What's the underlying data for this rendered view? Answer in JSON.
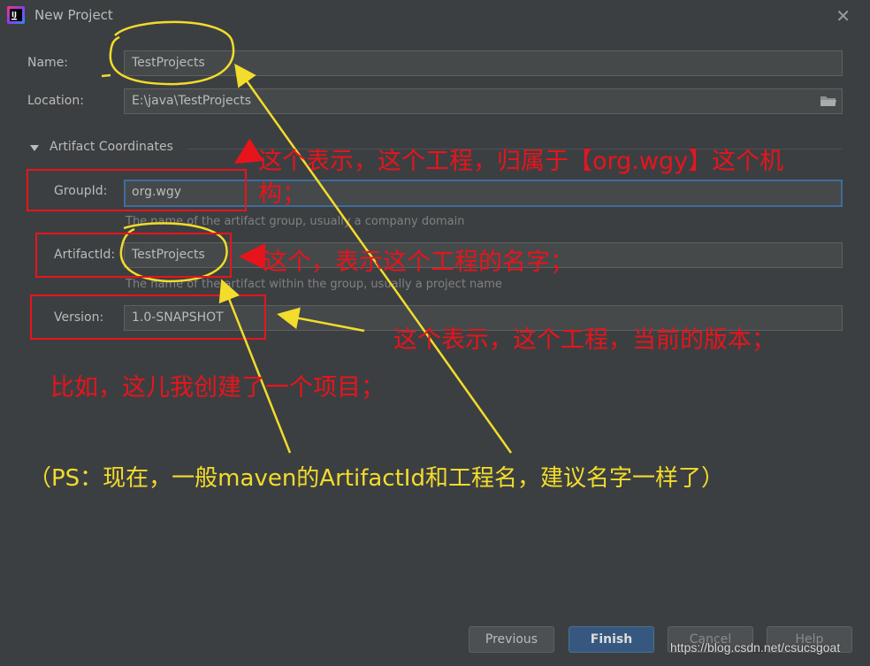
{
  "window": {
    "title": "New Project"
  },
  "form": {
    "name_label": "Name:",
    "name_value": "TestProjects",
    "location_label": "Location:",
    "location_value": "E:\\java\\TestProjects",
    "section_title": "Artifact Coordinates",
    "groupid_label": "GroupId:",
    "groupid_value": "org.wgy",
    "groupid_hint": "The name of the artifact group, usually a company domain",
    "artifactid_label": "ArtifactId:",
    "artifactid_value": "TestProjects",
    "artifactid_hint": "The name of the artifact within the group, usually a project name",
    "version_label": "Version:",
    "version_value": "1.0-SNAPSHOT"
  },
  "buttons": {
    "previous": "Previous",
    "finish": "Finish",
    "cancel": "Cancel",
    "help": "Help"
  },
  "annotations": {
    "groupid_note_line1": "这个表示，这个工程，归属于【org.wgy】这个机",
    "groupid_note_line2": "构；",
    "artifactid_note": "这个，表示这个工程的名字；",
    "version_note": "这个表示，这个工程，当前的版本；",
    "example_note": "比如，这儿我创建了一个项目；",
    "ps_note": "（PS：现在，一般maven的ArtifactId和工程名，建议名字一样了）"
  },
  "watermark": "https://blog.csdn.net/csucsgoat",
  "colors": {
    "background": "#3c3f41",
    "field_background": "#45494a",
    "focus_border": "#3d6d9e",
    "primary_button": "#365880",
    "annotation_red": "#e8141c",
    "annotation_yellow": "#f2dc2c"
  },
  "icons": [
    "intellij-app-icon",
    "close-icon",
    "folder-icon",
    "collapse-triangle-icon"
  ]
}
